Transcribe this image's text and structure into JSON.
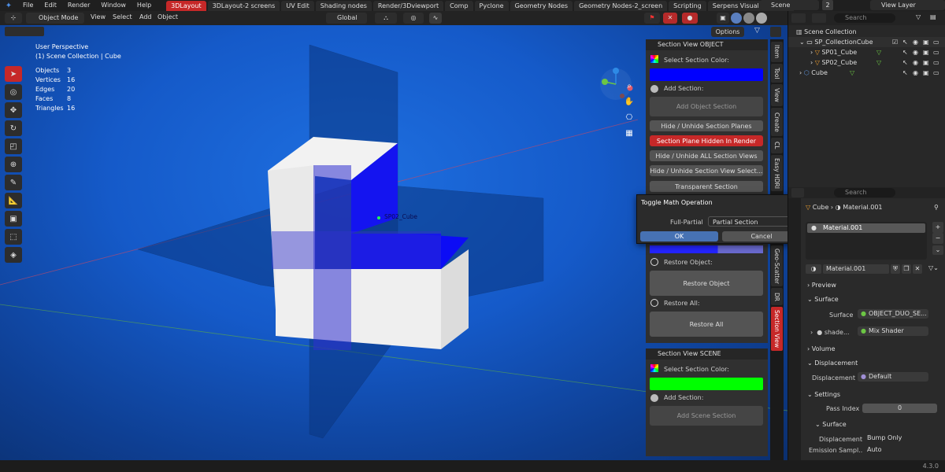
{
  "menu": [
    "File",
    "Edit",
    "Render",
    "Window",
    "Help"
  ],
  "workspace_tabs": [
    {
      "label": "3DLayout",
      "active": true
    },
    {
      "label": "3DLayout-2 screens",
      "active": false
    },
    {
      "label": "UV Edit",
      "active": false
    },
    {
      "label": "Shading nodes",
      "active": false
    },
    {
      "label": "Render/3Dviewport",
      "active": false
    },
    {
      "label": "Comp",
      "active": false
    },
    {
      "label": "Pyclone",
      "active": false
    },
    {
      "label": "Geometry Nodes",
      "active": false
    },
    {
      "label": "Geometry Nodes-2_screen",
      "active": false
    },
    {
      "label": "Scripting",
      "active": false
    },
    {
      "label": "Serpens Visual Scripting",
      "active": false
    }
  ],
  "scene": {
    "label": "Scene",
    "count": "2",
    "view_layer": "View Layer"
  },
  "viewport_header": {
    "mode": "Object Mode",
    "items": [
      "View",
      "Select",
      "Add",
      "Object"
    ],
    "transform": "Global",
    "options": "Options"
  },
  "overlay": {
    "perspective": "User Perspective",
    "collection": "(1) Scene Collection | Cube",
    "stats": [
      {
        "label": "Objects",
        "value": "3"
      },
      {
        "label": "Vertices",
        "value": "16"
      },
      {
        "label": "Edges",
        "value": "20"
      },
      {
        "label": "Faces",
        "value": "8"
      },
      {
        "label": "Triangles",
        "value": "16"
      }
    ],
    "object_label": "SP02_Cube"
  },
  "section_object": {
    "title": "Section View OBJECT",
    "select_color_label": "Select Section Color:",
    "color": "#0000ff",
    "add_section_label": "Add Section:",
    "add_object_section": "Add Object Section",
    "hide_planes": "Hide / Unhide Section Planes",
    "hidden_in_render": "Section Plane Hidden In Render",
    "hide_all_views": "Hide / Unhide ALL Section Views",
    "hide_selected_view": "Hide / Unhide Section View Select...",
    "transparent": "Transparent Section",
    "restore_object_label": "Restore Object:",
    "restore_object": "Restore Object",
    "restore_all_label": "Restore All:",
    "restore_all": "Restore All"
  },
  "section_scene": {
    "title": "Section View SCENE",
    "select_color_label": "Select Section Color:",
    "color": "#00ff00",
    "add_section_label": "Add Section:",
    "add_scene_section": "Add Scene Section"
  },
  "dialog": {
    "title": "Toggle Math Operation",
    "field_label": "Full-Partial",
    "field_value": "Partial Section",
    "ok": "OK",
    "cancel": "Cancel"
  },
  "side_tabs": [
    "Item",
    "Tool",
    "View",
    "Create",
    "CL",
    "Easy HDRI",
    "Geo-Scatter",
    "DR",
    "Section View"
  ],
  "outliner": {
    "search_placeholder": "Search",
    "root": "Scene Collection",
    "collection": "SP_CollectionCube",
    "items": [
      "SP01_Cube",
      "SP02_Cube",
      "Cube"
    ]
  },
  "properties": {
    "search_placeholder": "Search",
    "breadcrumb_object": "Cube",
    "breadcrumb_material": "Material.001",
    "slot": "Material.001",
    "material_name": "Material.001",
    "sections": {
      "preview": "Preview",
      "surface": "Surface",
      "volume": "Volume",
      "displacement": "Displacement",
      "settings": "Settings",
      "surface_sub": "Surface"
    },
    "surface_label": "Surface",
    "surface_value": "OBJECT_DUO_SE...",
    "shader_label": "shade...",
    "shader_value": "Mix Shader",
    "displacement_label": "Displacement",
    "displacement_value": "Default",
    "pass_index_label": "Pass Index",
    "pass_index_value": "0",
    "displacement2_label": "Displacement",
    "displacement2_value": "Bump Only",
    "emission_label": "Emission Sampl...",
    "emission_value": "Auto"
  },
  "version": "4.3.0"
}
